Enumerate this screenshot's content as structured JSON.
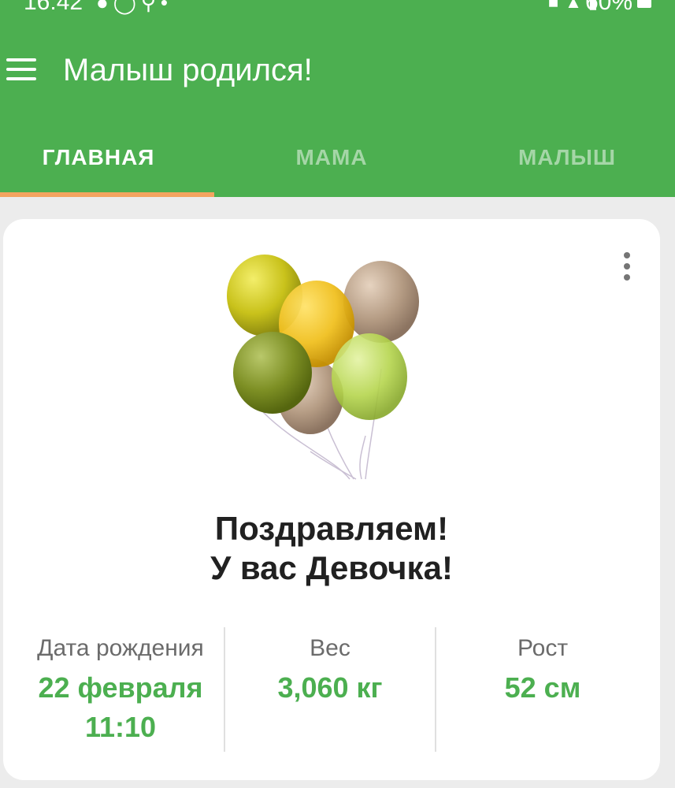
{
  "status_bar": {
    "time": "16:42",
    "battery": "60%"
  },
  "header": {
    "title": "Малыш родился!"
  },
  "tabs": [
    {
      "label": "ГЛАВНАЯ",
      "active": true
    },
    {
      "label": "МАМА",
      "active": false
    },
    {
      "label": "МАЛЫШ",
      "active": false
    }
  ],
  "card": {
    "congrats_line1": "Поздравляем!",
    "congrats_line2": "У вас Девочка!",
    "stats": [
      {
        "label": "Дата рождения",
        "value": "22 февраля",
        "value2": "11:10"
      },
      {
        "label": "Вес",
        "value": "3,060 кг"
      },
      {
        "label": "Рост",
        "value": "52 см"
      }
    ]
  },
  "colors": {
    "appbar": "#4caf50",
    "tab_indicator": "#f4a460",
    "accent_text": "#4caf50"
  },
  "icons": [
    "menu-icon",
    "more-vert-icon",
    "balloons-image",
    "message-icon",
    "whatsapp-icon",
    "search-icon",
    "battery-icon",
    "wifi-icon",
    "signal-icon",
    "mute-icon"
  ]
}
